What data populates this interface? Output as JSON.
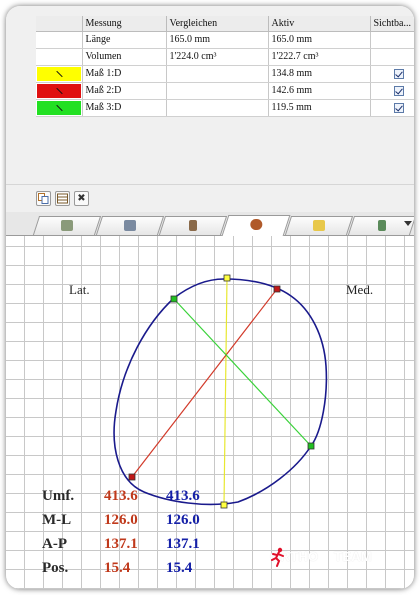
{
  "table": {
    "headers": [
      "Messung",
      "Vergleichen",
      "Aktiv",
      "Sichtba..."
    ],
    "rows": [
      {
        "name": "Länge",
        "compare": "165.0 mm",
        "active": "165.0 mm",
        "swatch": null,
        "visible": false
      },
      {
        "name": "Volumen",
        "compare": "1'224.0 cm³",
        "active": "1'222.7 cm³",
        "swatch": null,
        "visible": false
      },
      {
        "name": "Maß 1:D",
        "compare": "",
        "active": "134.8 mm",
        "swatch": "#ffff00",
        "visible": true
      },
      {
        "name": "Maß 2:D",
        "compare": "",
        "active": "142.6 mm",
        "swatch": "#e01010",
        "visible": true
      },
      {
        "name": "Maß 3:D",
        "compare": "",
        "active": "119.5 mm",
        "swatch": "#22e022",
        "visible": true
      }
    ]
  },
  "mini_toolbar": {
    "icons": [
      "copy-icon",
      "table-icon",
      "close-icon"
    ],
    "close_glyph": "✖"
  },
  "tabs": {
    "icons": [
      "tools-icon",
      "image-icon",
      "hammer-icon",
      "foot-icon",
      "note-icon",
      "tree-icon"
    ],
    "active_index": 3
  },
  "canvas": {
    "lateral_label": "Lat.",
    "medial_label": "Med.",
    "stats": [
      {
        "label": "Umf.",
        "compare": "413.6",
        "active": "413.6"
      },
      {
        "label": "M-L",
        "compare": "126.0",
        "active": "126.0"
      },
      {
        "label": "A-P",
        "compare": "137.1",
        "active": "137.1"
      },
      {
        "label": "Pos.",
        "compare": "15.4",
        "active": "15.4"
      }
    ],
    "colors": {
      "outline": "#1a1a8c",
      "measure_1": "#e8e830",
      "measure_2": "#d23a2a",
      "measure_3": "#3ad23a",
      "compare_value": "#c0391b",
      "active_value": "#1520a8"
    }
  },
  "logo": {
    "part1": "ORTHO",
    "part2": "TEAM",
    "accent": "#e0102a"
  }
}
